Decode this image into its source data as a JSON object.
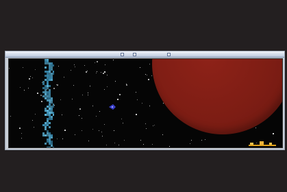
{
  "screen": {
    "background_color": "#231f20"
  },
  "game": {
    "window_frame_color": "#c9cfd8",
    "space_color": "#050505",
    "star_color": "#d9d9d9",
    "planet": {
      "name_icon": "red-planet-icon",
      "color": "#7d1d14"
    },
    "nebula": {
      "name_icon": "blue-nebula-icon",
      "color": "#3b8fb6"
    },
    "player": {
      "name_icon": "player-ship-icon",
      "color": "#3a3fc9"
    },
    "gauge": {
      "name_icon": "energy-gauge-icon",
      "color": "#e0a11a"
    }
  }
}
